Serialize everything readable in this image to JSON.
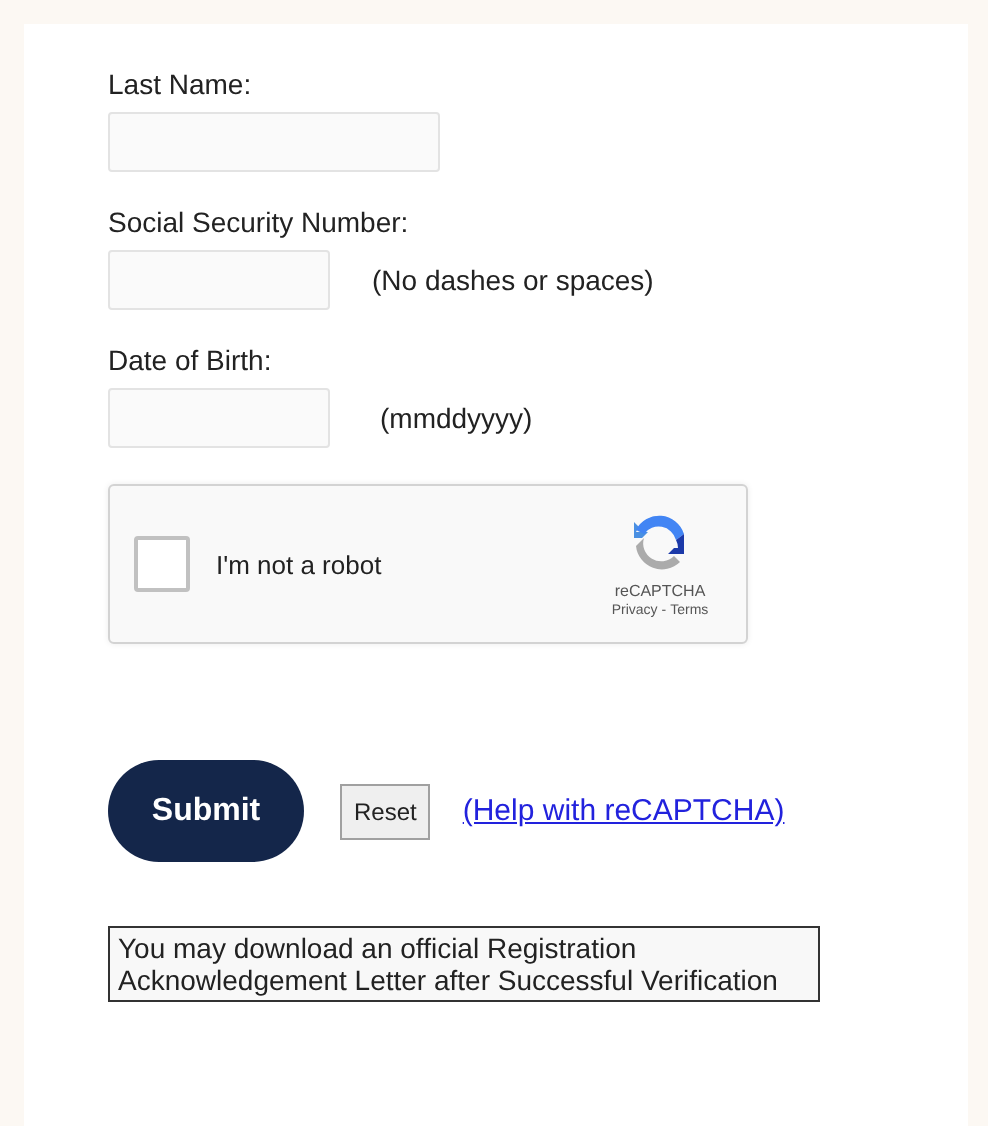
{
  "fields": [
    {
      "label": "Last Name:",
      "kind": "wide"
    },
    {
      "label": "Social Security Number:",
      "kind": "short",
      "hint": "(No dashes or spaces)"
    },
    {
      "label": "Date of Birth:",
      "kind": "short",
      "hint": "(mmddyyyy)"
    }
  ],
  "captcha": {
    "label": "I'm not a robot",
    "checked": false,
    "brand": "reCAPTCHA",
    "privacy": "Privacy",
    "separator": "-",
    "terms": "Terms"
  },
  "submit": "Submit",
  "reset": "Reset",
  "help_link": "(Help with reCAPTCHA)",
  "notice": "You may download an official Registration Acknowledgement Letter after Successful Verification"
}
